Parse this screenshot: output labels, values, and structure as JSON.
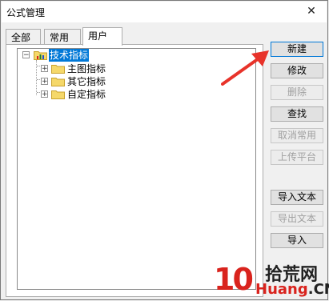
{
  "window": {
    "title": "公式管理",
    "close_glyph": "✕"
  },
  "tabs": [
    {
      "label": "全部",
      "active": false
    },
    {
      "label": "常用",
      "active": false
    },
    {
      "label": "用户",
      "active": true
    }
  ],
  "tree": {
    "root": {
      "label": "技术指标",
      "expanded": true,
      "selected": true,
      "toggle": "−"
    },
    "children": [
      {
        "label": "主图指标",
        "toggle": "+"
      },
      {
        "label": "其它指标",
        "toggle": "+"
      },
      {
        "label": "自定指标",
        "toggle": "+"
      }
    ]
  },
  "buttons": [
    {
      "label": "新建",
      "enabled": true
    },
    {
      "label": "修改",
      "enabled": true
    },
    {
      "label": "删除",
      "enabled": false
    },
    {
      "label": "查找",
      "enabled": true
    },
    {
      "label": "取消常用",
      "enabled": false
    },
    {
      "label": "上传平台",
      "enabled": false
    },
    {
      "label": "导入文本",
      "enabled": true
    },
    {
      "label": "导出文本",
      "enabled": false
    },
    {
      "label": "导入",
      "enabled": true
    }
  ],
  "watermark": {
    "logo": "10",
    "cn": "拾荒网",
    "en_colored": "Huang",
    "en_plain": ".CN"
  },
  "colors": {
    "selection": "#0078d7",
    "arrow": "#e8332a",
    "folder": "#f5d86a"
  }
}
